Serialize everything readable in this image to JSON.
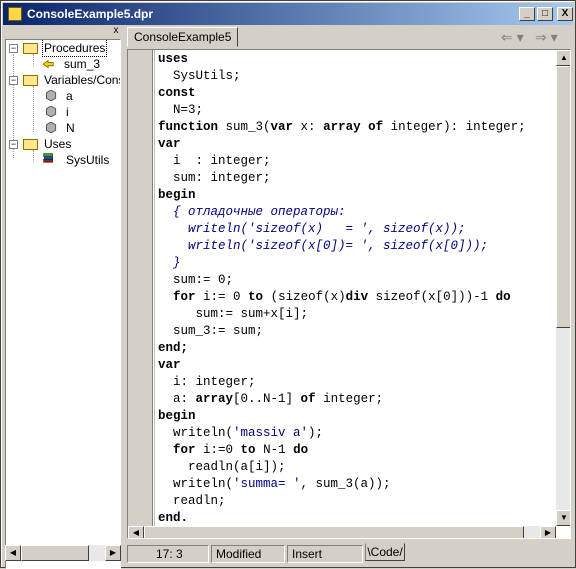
{
  "window": {
    "title": "ConsoleExample5.dpr",
    "controls": {
      "minimize": "_",
      "maximize": "□",
      "close": "X"
    }
  },
  "pane": {
    "close": "x"
  },
  "tree": {
    "procedures": "Procedures",
    "sum_3": "sum_3",
    "variables": "Variables/Const",
    "var_a": "a",
    "var_i": "i",
    "var_N": "N",
    "uses": "Uses",
    "sysutils": "SysUtils",
    "minus": "−"
  },
  "tabs": {
    "active": "ConsoleExample5"
  },
  "nav": {
    "back": "⇐ ▾",
    "forward": "⇒ ▾"
  },
  "scroll": {
    "up": "▲",
    "down": "▼",
    "left": "◀",
    "right": "▶"
  },
  "code": {
    "l01": "uses",
    "l02": "  SysUtils;",
    "l03": "const",
    "l04": "  N=3;",
    "l05a": "function",
    "l05b": " sum_3(",
    "l05c": "var",
    "l05d": " x: ",
    "l05e": "array of",
    "l05f": " integer): integer;",
    "l06": "var",
    "l07": "  i  : integer;",
    "l08": "  sum: integer;",
    "l09": "begin",
    "l10": "  { отладочные операторы:",
    "l11": "    writeln('sizeof(x)   = ', sizeof(x));",
    "l12": "    writeln('sizeof(x[0])= ', sizeof(x[0]));",
    "l13": "  }",
    "l14": "  sum:= 0;",
    "l15a": "  ",
    "l15b": "for",
    "l15c": " i:= 0 ",
    "l15d": "to",
    "l15e": " (sizeof(x)",
    "l15f": "div",
    "l15g": " sizeof(x[0]))-1 ",
    "l15h": "do",
    "l16": "     sum:= sum+x[i];",
    "l17": "  sum_3:= sum;",
    "l18": "end;",
    "l19": "var",
    "l20": "  i: integer;",
    "l21a": "  a: ",
    "l21b": "array",
    "l21c": "[0..N-1] ",
    "l21d": "of",
    "l21e": " integer;",
    "l22": "begin",
    "l23a": "  writeln(",
    "l23b": "'massiv a'",
    "l23c": ");",
    "l24a": "  ",
    "l24b": "for",
    "l24c": " i:=0 ",
    "l24d": "to",
    "l24e": " N-1 ",
    "l24f": "do",
    "l25": "    readln(a[i]);",
    "l26a": "  writeln(",
    "l26b": "'summa= '",
    "l26c": ", sum_3(a));",
    "l27": "  readln;",
    "l28": "end."
  },
  "status": {
    "position": "17:  3",
    "modified": "Modified",
    "mode": "Insert",
    "code_tab": "\\Code/"
  }
}
